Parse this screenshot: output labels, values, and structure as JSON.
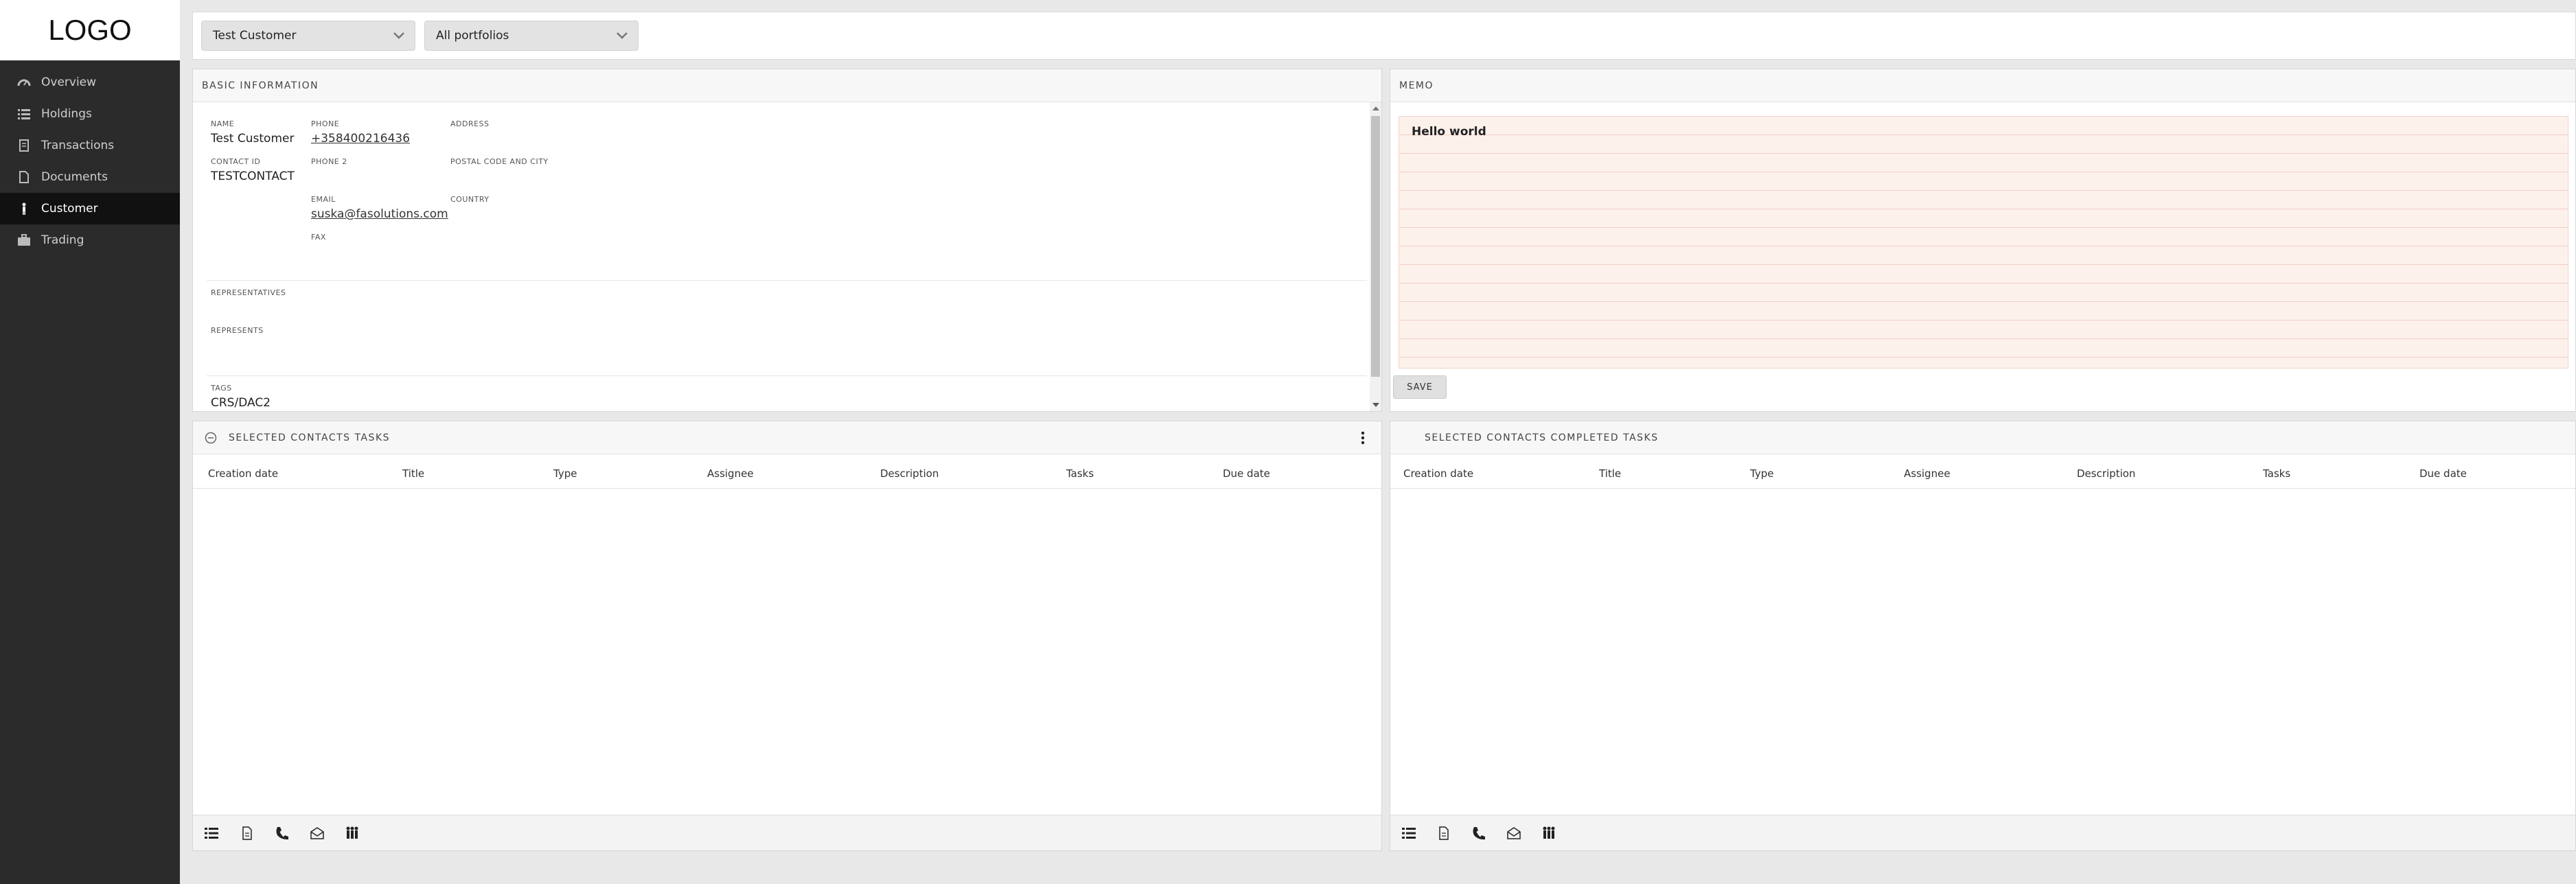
{
  "app": {
    "logo_text": "LOGO"
  },
  "sidebar": {
    "items": [
      {
        "label": "Overview",
        "icon": "gauge-icon",
        "active": false
      },
      {
        "label": "Holdings",
        "icon": "list-icon",
        "active": false
      },
      {
        "label": "Transactions",
        "icon": "receipt-icon",
        "active": false
      },
      {
        "label": "Documents",
        "icon": "document-icon",
        "active": false
      },
      {
        "label": "Customer",
        "icon": "person-icon",
        "active": true
      },
      {
        "label": "Trading",
        "icon": "briefcase-icon",
        "active": false
      }
    ]
  },
  "topbar": {
    "customer_select": "Test Customer",
    "portfolio_select": "All portfolios"
  },
  "basic_info": {
    "title": "BASIC INFORMATION",
    "name_label": "NAME",
    "name_value": "Test Customer",
    "contact_id_label": "CONTACT ID",
    "contact_id_value": "TESTCONTACT",
    "phone_label": "PHONE",
    "phone_value": "+358400216436",
    "phone2_label": "PHONE 2",
    "email_label": "EMAIL",
    "email_value": "suska@fasolutions.com",
    "fax_label": "FAX",
    "address_label": "ADDRESS",
    "postal_label": "POSTAL CODE AND CITY",
    "country_label": "COUNTRY",
    "representatives_label": "REPRESENTATIVES",
    "represents_label": "REPRESENTS",
    "tags_label": "TAGS",
    "tags_value": "CRS/DAC2"
  },
  "memo": {
    "title": "MEMO",
    "text": "Hello world",
    "save_label": "SAVE",
    "paper_color": "#fdf1ec",
    "line_color": "#f3cfc4"
  },
  "tasks": {
    "title": "SELECTED CONTACTS TASKS",
    "columns": [
      "Creation date",
      "Title",
      "Type",
      "Assignee",
      "Description",
      "Tasks",
      "Due date"
    ]
  },
  "completed_tasks": {
    "title": "SELECTED CONTACTS COMPLETED TASKS",
    "columns": [
      "Creation date",
      "Title",
      "Type",
      "Assignee",
      "Description",
      "Tasks",
      "Due date"
    ]
  },
  "footer_tools": [
    "list-icon",
    "document-icon",
    "phone-icon",
    "envelope-icon",
    "meeting-icon"
  ]
}
